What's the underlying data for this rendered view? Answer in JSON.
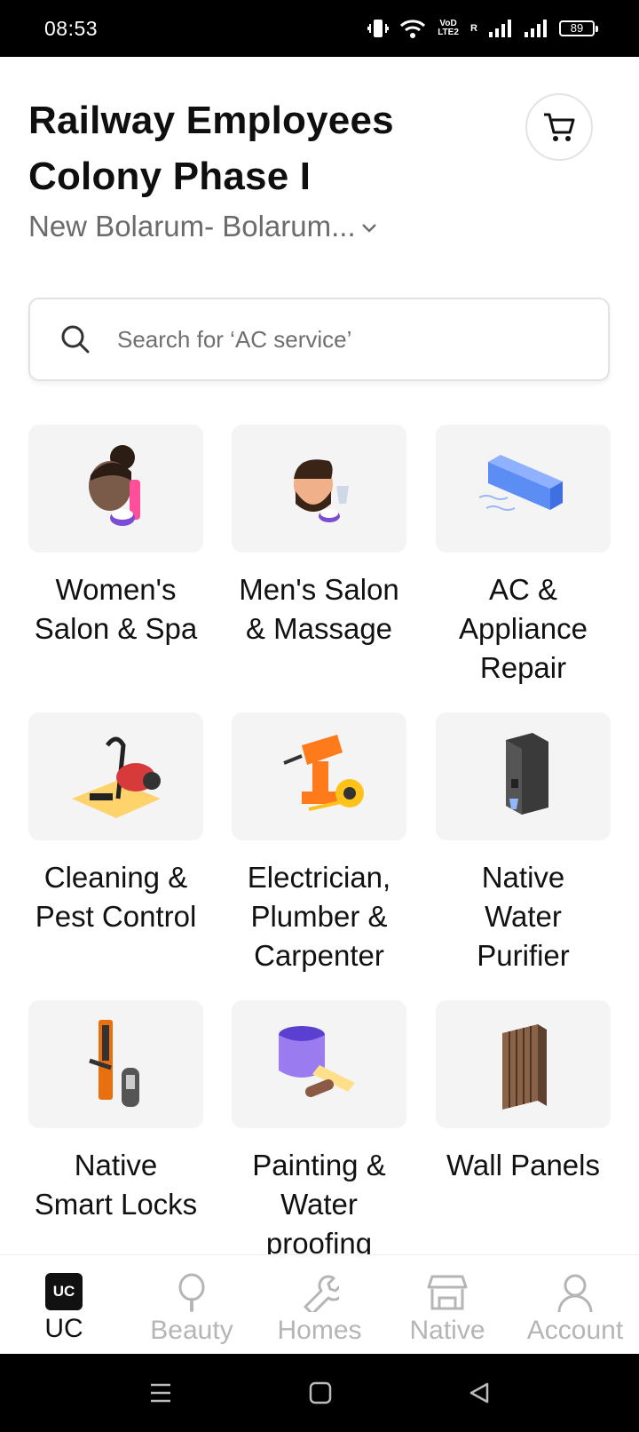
{
  "status_bar": {
    "time": "08:53",
    "network_label": "VoD LTE2",
    "roaming": "R",
    "battery": "89"
  },
  "header": {
    "title_line1": "Railway Employees",
    "title_line2": "Colony Phase I",
    "subtitle": "New Bolarum- Bolarum..."
  },
  "search": {
    "placeholder": "Search for ‘AC service’"
  },
  "categories": [
    {
      "label": "Women's Salon & Spa"
    },
    {
      "label": "Men's Salon & Massage"
    },
    {
      "label": "AC & Appliance Repair"
    },
    {
      "label": "Cleaning & Pest Control"
    },
    {
      "label": "Electrician, Plumber & Carpenter"
    },
    {
      "label": "Native Water Purifier"
    },
    {
      "label": "Native Smart Locks"
    },
    {
      "label": "Painting & Water proofing"
    },
    {
      "label": "Wall Panels"
    }
  ],
  "bottom_nav": {
    "items": [
      {
        "label": "UC",
        "icon": "uc-logo-icon",
        "active": true
      },
      {
        "label": "Beauty",
        "icon": "mirror-icon"
      },
      {
        "label": "Homes",
        "icon": "wrench-icon"
      },
      {
        "label": "Native",
        "icon": "store-icon"
      },
      {
        "label": "Account",
        "icon": "person-icon"
      }
    ],
    "uc_logo_text": "UC"
  },
  "colors": {
    "accent": "#111111",
    "inactive": "#b5b5b5",
    "tile_bg": "#f4f4f4"
  }
}
